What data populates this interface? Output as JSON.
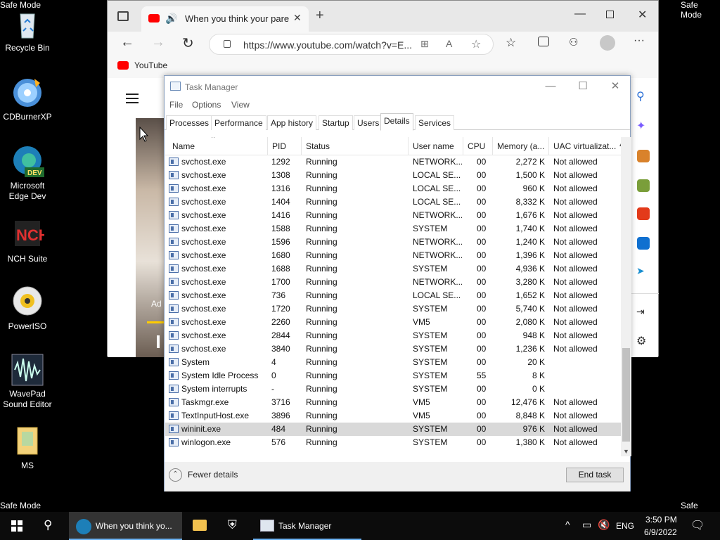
{
  "desktop": {
    "safe_mode_label": "Safe Mode",
    "icons": [
      {
        "name": "recycle-bin",
        "line1": "Recycle Bin",
        "line2": ""
      },
      {
        "name": "cdburnerxp",
        "line1": "CDBurnerXP",
        "line2": ""
      },
      {
        "name": "edge-dev",
        "line1": "Microsoft",
        "line2": "Edge Dev"
      },
      {
        "name": "nch-suite",
        "line1": "NCH Suite",
        "line2": ""
      },
      {
        "name": "poweriso",
        "line1": "PowerISO",
        "line2": ""
      },
      {
        "name": "wavepad",
        "line1": "WavePad",
        "line2": "Sound Editor"
      },
      {
        "name": "ms-folder",
        "line1": "MS",
        "line2": ""
      }
    ]
  },
  "browser": {
    "tab_title": "When you think your parent",
    "url": "https://www.youtube.com/watch?v=E...",
    "favorite": "YouTube",
    "video_overlay": "Ad"
  },
  "task_manager": {
    "title": "Task Manager",
    "menu": [
      "File",
      "Options",
      "View"
    ],
    "tabs": [
      "Processes",
      "Performance",
      "App history",
      "Startup",
      "Users",
      "Details",
      "Services"
    ],
    "active_tab": "Details",
    "columns": [
      "Name",
      "PID",
      "Status",
      "User name",
      "CPU",
      "Memory (a...",
      "UAC virtualizat..."
    ],
    "rows": [
      [
        "svchost.exe",
        "1292",
        "Running",
        "NETWORK...",
        "00",
        "2,272 K",
        "Not allowed"
      ],
      [
        "svchost.exe",
        "1308",
        "Running",
        "LOCAL SE...",
        "00",
        "1,500 K",
        "Not allowed"
      ],
      [
        "svchost.exe",
        "1316",
        "Running",
        "LOCAL SE...",
        "00",
        "960 K",
        "Not allowed"
      ],
      [
        "svchost.exe",
        "1404",
        "Running",
        "LOCAL SE...",
        "00",
        "8,332 K",
        "Not allowed"
      ],
      [
        "svchost.exe",
        "1416",
        "Running",
        "NETWORK...",
        "00",
        "1,676 K",
        "Not allowed"
      ],
      [
        "svchost.exe",
        "1588",
        "Running",
        "SYSTEM",
        "00",
        "1,740 K",
        "Not allowed"
      ],
      [
        "svchost.exe",
        "1596",
        "Running",
        "NETWORK...",
        "00",
        "1,240 K",
        "Not allowed"
      ],
      [
        "svchost.exe",
        "1680",
        "Running",
        "NETWORK...",
        "00",
        "1,396 K",
        "Not allowed"
      ],
      [
        "svchost.exe",
        "1688",
        "Running",
        "SYSTEM",
        "00",
        "4,936 K",
        "Not allowed"
      ],
      [
        "svchost.exe",
        "1700",
        "Running",
        "NETWORK...",
        "00",
        "3,280 K",
        "Not allowed"
      ],
      [
        "svchost.exe",
        "736",
        "Running",
        "LOCAL SE...",
        "00",
        "1,652 K",
        "Not allowed"
      ],
      [
        "svchost.exe",
        "1720",
        "Running",
        "SYSTEM",
        "00",
        "5,740 K",
        "Not allowed"
      ],
      [
        "svchost.exe",
        "2260",
        "Running",
        "VM5",
        "00",
        "2,080 K",
        "Not allowed"
      ],
      [
        "svchost.exe",
        "2844",
        "Running",
        "SYSTEM",
        "00",
        "948 K",
        "Not allowed"
      ],
      [
        "svchost.exe",
        "3840",
        "Running",
        "SYSTEM",
        "00",
        "1,236 K",
        "Not allowed"
      ],
      [
        "System",
        "4",
        "Running",
        "SYSTEM",
        "00",
        "20 K",
        ""
      ],
      [
        "System Idle Process",
        "0",
        "Running",
        "SYSTEM",
        "55",
        "8 K",
        ""
      ],
      [
        "System interrupts",
        "-",
        "Running",
        "SYSTEM",
        "00",
        "0 K",
        ""
      ],
      [
        "Taskmgr.exe",
        "3716",
        "Running",
        "VM5",
        "00",
        "12,476 K",
        "Not allowed"
      ],
      [
        "TextInputHost.exe",
        "3896",
        "Running",
        "VM5",
        "00",
        "8,848 K",
        "Not allowed"
      ],
      [
        "wininit.exe",
        "484",
        "Running",
        "SYSTEM",
        "00",
        "976 K",
        "Not allowed"
      ],
      [
        "winlogon.exe",
        "576",
        "Running",
        "SYSTEM",
        "00",
        "1,380 K",
        "Not allowed"
      ]
    ],
    "selected_row": "wininit.exe",
    "fewer_details": "Fewer details",
    "end_task": "End task"
  },
  "taskbar": {
    "edge_item": "When you think yo...",
    "task_manager_item": "Task Manager",
    "language": "ENG",
    "time": "3:50 PM",
    "date": "6/9/2022"
  }
}
